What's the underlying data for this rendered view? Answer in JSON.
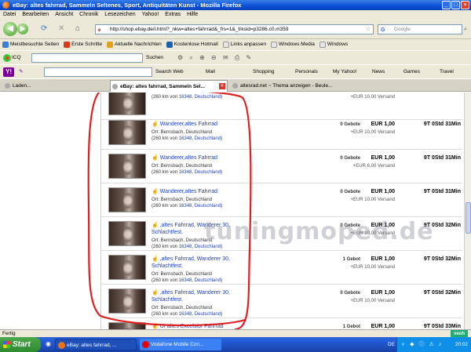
{
  "window": {
    "title": "eBay: altes fahrrad, Sammeln Seltenes, Sport, Antiquitäten Kunst - Mozilla Firefox"
  },
  "menu": [
    "Datei",
    "Bearbeiten",
    "Ansicht",
    "Chronik",
    "Lesezeichen",
    "Yahoo!",
    "Extras",
    "Hilfe"
  ],
  "nav": {
    "url": "http://shop.ebay.de/i.html?_nkw=altes+fahrrad&_frs=1&_trksid=p3286.c0.m359",
    "search_placeholder": "Google"
  },
  "bookmarks": [
    {
      "label": "Meistbesuchte Seiten",
      "color": "#3a7fd5"
    },
    {
      "label": "Erste Schritte",
      "color": "#d83a1a"
    },
    {
      "label": "Aktuelle Nachrichten",
      "color": "#e0a020"
    },
    {
      "label": "Kostenlose Hotmail",
      "color": "#1a5fb0"
    },
    {
      "label": "Links anpassen",
      "color": "#e6e6e6"
    },
    {
      "label": "Windows Media",
      "color": "#e6e6e6"
    },
    {
      "label": "Windows",
      "color": "#e6e6e6"
    }
  ],
  "icq": {
    "label": "ICQ",
    "search": "Suchen"
  },
  "yahoo": {
    "search_web": "Search Web",
    "items": [
      "Mail",
      "Shopping",
      "Personals",
      "My Yahoo!",
      "News",
      "Games",
      "Travel"
    ]
  },
  "tabs": [
    {
      "label": "Laden...",
      "active": false
    },
    {
      "label": "eBay: altes fahrrad, Sammeln Sel...",
      "active": true
    },
    {
      "label": "altesrad.net ~ Thema anzeigen - Beule...",
      "active": false
    }
  ],
  "listings": [
    {
      "title": "",
      "loc": "Ort: Bernsbach, Deutschland",
      "dist": "(260 km von ",
      "zip": "16348, Deutschland",
      "dist_end": ")",
      "bids": "",
      "price": "",
      "shipping": "+EUR 10,00 Versand",
      "time": ""
    },
    {
      "title": "Wanderer,altes Fahrrad",
      "loc": "Ort: Bernsbach, Deutschland",
      "dist": "(260 km von ",
      "zip": "16348, Deutschland",
      "dist_end": ")",
      "bids": "0 Gebote",
      "price": "EUR 1,00",
      "shipping": "+EUR 10,00 Versand",
      "time": "9T 0Std 31Min"
    },
    {
      "title": "Wanderer,altes Fahrrad",
      "loc": "Ort: Bernsbach, Deutschland",
      "dist": "(260 km von ",
      "zip": "16348, Deutschland",
      "dist_end": ")",
      "bids": "0 Gebote",
      "price": "EUR 1,00",
      "shipping": "+EUR 6,00 Versand",
      "time": "9T 0Std 31Min"
    },
    {
      "title": "Wanderer,altes Fahrrad",
      "loc": "Ort: Bernsbach, Deutschland",
      "dist": "(260 km von ",
      "zip": "16348, Deutschland",
      "dist_end": ")",
      "bids": "0 Gebote",
      "price": "EUR 1,00",
      "shipping": "+EUR 10,00 Versand",
      "time": "9T 0Std 31Min"
    },
    {
      "title": ",altes Fahrrad, Wanderer 30, Schlachtfest.",
      "loc": "Ort: Bernsbach, Deutschland",
      "dist": "(260 km von ",
      "zip": "16348, Deutschland",
      "dist_end": ")",
      "bids": "0 Gebote",
      "price": "EUR 1,00",
      "shipping": "+EUR 10,00 Versand",
      "time": "9T 0Std 32Min"
    },
    {
      "title": ",altes Fahrrad, Wanderer 30, Schlachtfest.",
      "loc": "Ort: Bernsbach, Deutschland",
      "dist": "(260 km von ",
      "zip": "16348, Deutschland",
      "dist_end": ")",
      "bids": "1 Gebot",
      "price": "EUR 1,00",
      "shipping": "+EUR 10,00 Versand",
      "time": "9T 0Std 32Min"
    },
    {
      "title": ",altes Fahrrad, Wanderer 30, Schlachtfest.",
      "loc": "Ort: Bernsbach, Deutschland",
      "dist": "(260 km von ",
      "zip": "16348, Deutschland",
      "dist_end": ")",
      "bids": "0 Gebote",
      "price": "EUR 1,00",
      "shipping": "+EUR 10,00 Versand",
      "time": "9T 0Std 32Min"
    },
    {
      "title": "Ur altes Excelsior Fahrrad",
      "loc": "",
      "dist": "",
      "zip": "",
      "dist_end": "",
      "bids": "1 Gebot",
      "price": "EUR 1,00",
      "shipping": "",
      "time": "9T 0Std 33Min"
    }
  ],
  "watermark": "tuningmoped.de",
  "status": {
    "text": "Fertig",
    "veoh": "veoh"
  },
  "taskbar": {
    "start": "Start",
    "items": [
      {
        "label": "eBay: altes fahrrad, ...",
        "color": "#e8731a"
      },
      {
        "label": "Vodafone Mobile Con...",
        "color": "#e60000"
      }
    ],
    "lang": "DE",
    "clock": "20:02"
  },
  "colors": {
    "annotation": "#e02020",
    "link": "#1d3fbb"
  }
}
